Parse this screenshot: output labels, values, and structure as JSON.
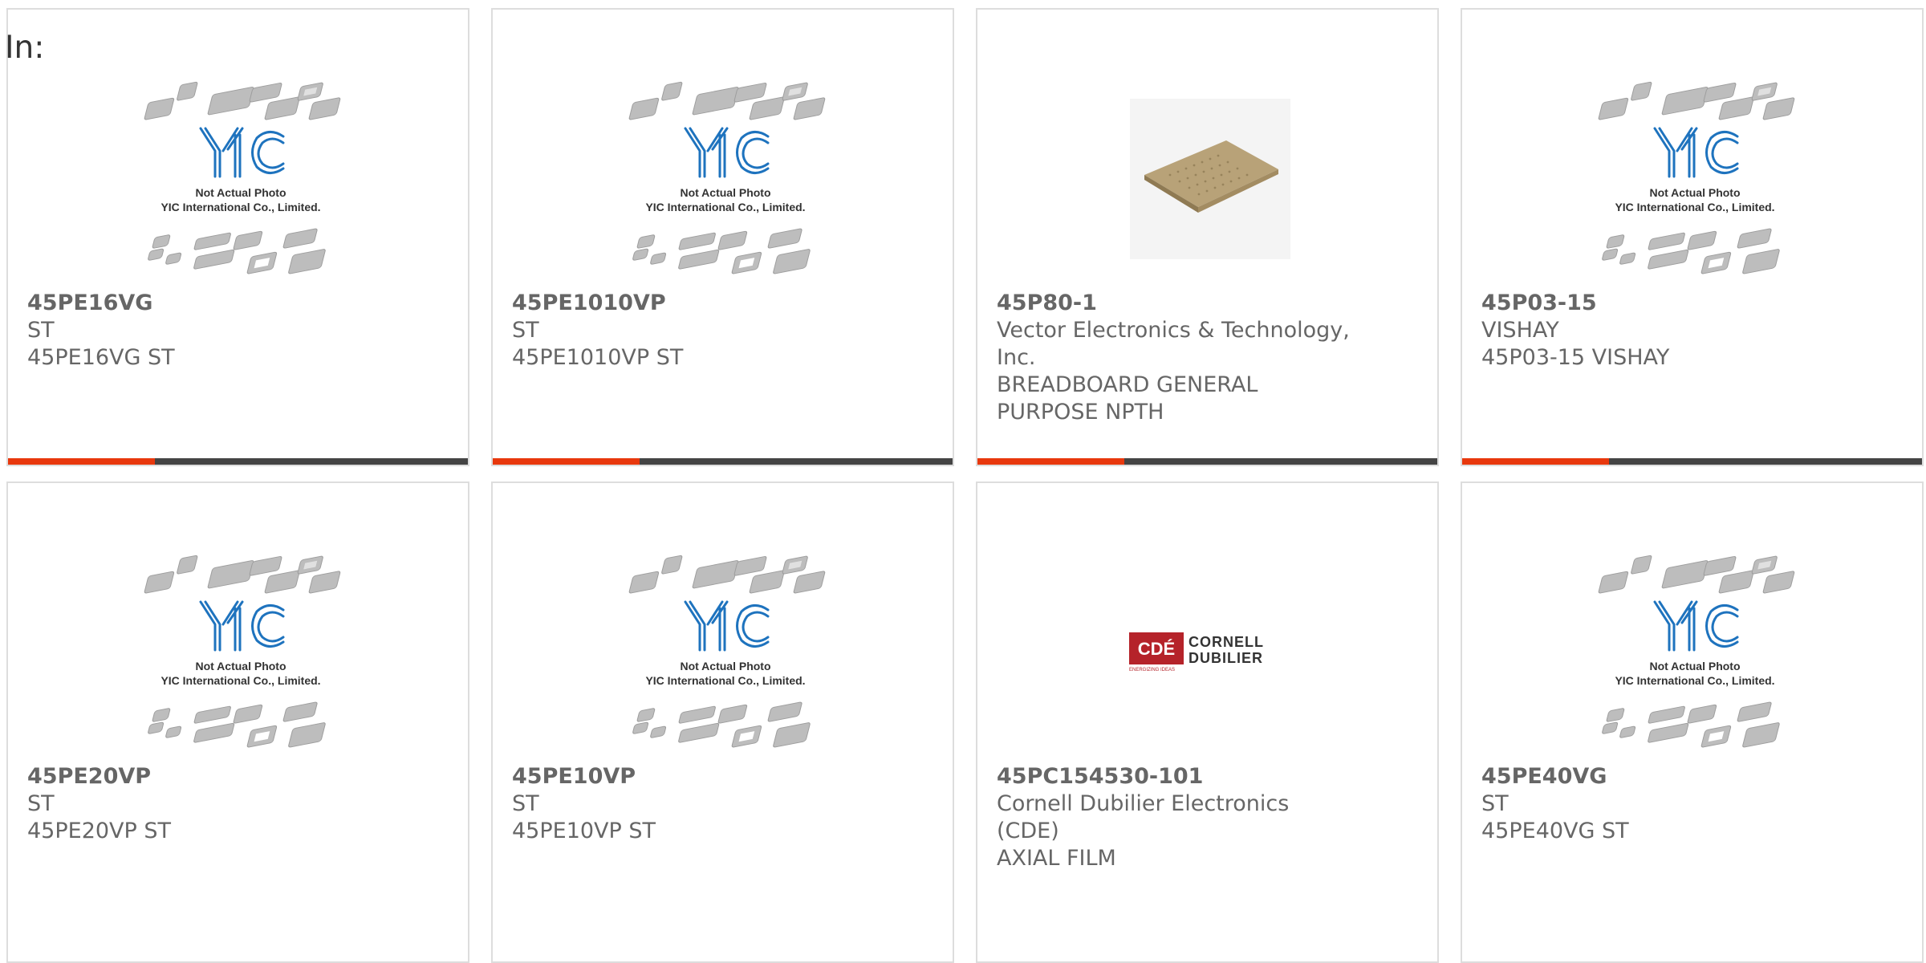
{
  "header": {
    "prefix": "In:"
  },
  "photo_notice": {
    "line1": "Not Actual Photo",
    "line2": "YIC International Co., Limited.",
    "logo_text": "YIC"
  },
  "cde_logo": {
    "badge": "CDÉ",
    "line1": "CORNELL",
    "line2": "DUBILIER",
    "tagline": "ENERGIZING IDEAS"
  },
  "colors": {
    "accent": "#e8380d",
    "bar_dark": "#444444",
    "border": "#dddddd",
    "text": "#666666",
    "yic_blue": "#1e73be"
  },
  "products": [
    {
      "part": "45PE16VG",
      "maker": "ST",
      "desc": "45PE16VG ST",
      "image": "yic-placeholder"
    },
    {
      "part": "45PE1010VP",
      "maker": "ST",
      "desc": "45PE1010VP ST",
      "image": "yic-placeholder"
    },
    {
      "part": "45P80-1",
      "maker": "Vector Electronics & Technology, Inc.",
      "desc": "BREADBOARD GENERAL PURPOSE NPTH",
      "image": "breadboard"
    },
    {
      "part": "45P03-15",
      "maker": "VISHAY",
      "desc": "45P03-15 VISHAY",
      "image": "yic-placeholder"
    },
    {
      "part": "45PE20VP",
      "maker": "ST",
      "desc": "45PE20VP ST",
      "image": "yic-placeholder"
    },
    {
      "part": "45PE10VP",
      "maker": "ST",
      "desc": "45PE10VP ST",
      "image": "yic-placeholder"
    },
    {
      "part": "45PC154530-101",
      "maker": "Cornell Dubilier Electronics (CDE)",
      "desc": "AXIAL FILM",
      "image": "cde-logo"
    },
    {
      "part": "45PE40VG",
      "maker": "ST",
      "desc": "45PE40VG ST",
      "image": "yic-placeholder"
    }
  ]
}
